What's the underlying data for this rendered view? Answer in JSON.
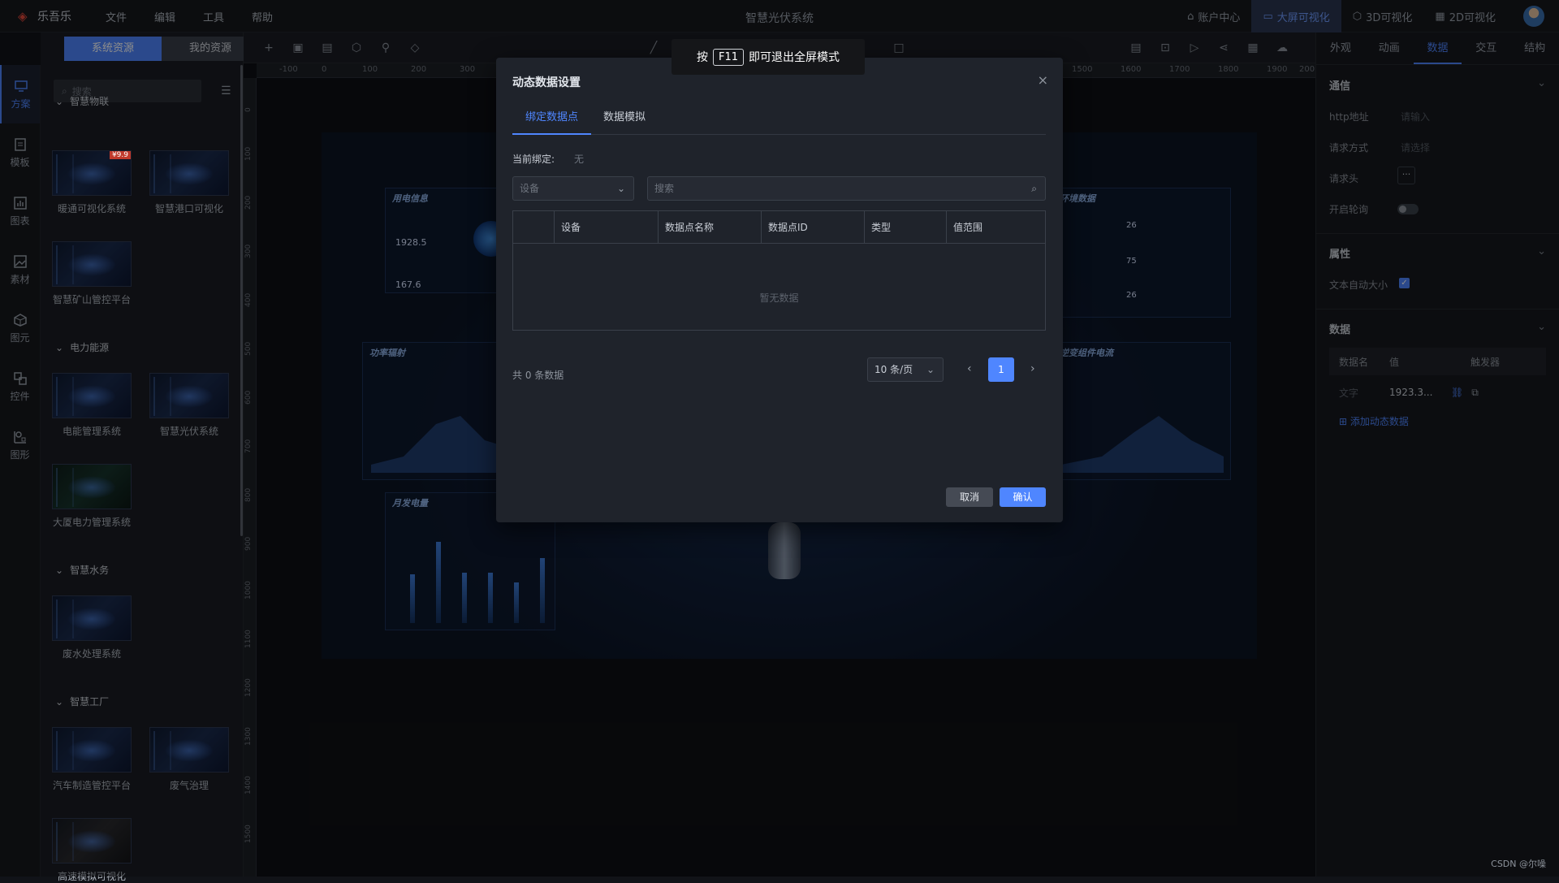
{
  "app": {
    "name": "乐吾乐",
    "title": "智慧光伏系统",
    "menu": [
      "文件",
      "编辑",
      "工具",
      "帮助"
    ],
    "right_buttons": [
      {
        "icon": "home-icon",
        "label": "账户中心",
        "active": false
      },
      {
        "icon": "monitor-icon",
        "label": "大屏可视化",
        "active": true
      },
      {
        "icon": "cube-icon",
        "label": "3D可视化",
        "active": false
      },
      {
        "icon": "grid-icon",
        "label": "2D可视化",
        "active": false
      }
    ],
    "accent": "#4f86ff"
  },
  "sidebar": {
    "items": [
      {
        "icon": "monitor-icon",
        "label": "方案",
        "active": true
      },
      {
        "icon": "template-icon",
        "label": "模板",
        "active": false
      },
      {
        "icon": "chart-icon",
        "label": "图表",
        "active": false
      },
      {
        "icon": "image-icon",
        "label": "素材",
        "active": false
      },
      {
        "icon": "cube-icon",
        "label": "图元",
        "active": false
      },
      {
        "icon": "control-icon",
        "label": "控件",
        "active": false
      },
      {
        "icon": "shape-icon",
        "label": "图形",
        "active": false
      }
    ]
  },
  "resources": {
    "tabs": [
      "系统资源",
      "我的资源"
    ],
    "search_placeholder": "搜索",
    "categories": [
      {
        "name": "智慧物联",
        "items": [
          "暖通可视化系统",
          "智慧港口可视化",
          "智慧矿山管控平台"
        ],
        "badge": "¥9.9"
      },
      {
        "name": "电力能源",
        "items": [
          "电能管理系统",
          "智慧光伏系统",
          "大厦电力管理系统"
        ]
      },
      {
        "name": "智慧水务",
        "items": [
          "废水处理系统"
        ]
      },
      {
        "name": "智慧工厂",
        "items": [
          "汽车制造管控平台",
          "废气治理",
          "高速模拟可视化"
        ]
      }
    ]
  },
  "stage": {
    "panels": [
      "用电信息",
      "功率辐射",
      "月发电量",
      "环境数据",
      "逆变组件电流"
    ],
    "values": [
      "1928.5",
      "167.6",
      "26",
      "75",
      "26"
    ]
  },
  "ruler": {
    "top": [
      "-100",
      "0",
      "100",
      "200",
      "300",
      "1500",
      "1600",
      "1700",
      "1800",
      "1900",
      "200"
    ],
    "left": [
      "0",
      "100",
      "200",
      "300",
      "400",
      "500",
      "600",
      "700",
      "800",
      "900",
      "1000",
      "1100",
      "1200",
      "1300",
      "1400",
      "1500"
    ]
  },
  "toast": {
    "prefix": "按",
    "key": "F11",
    "suffix": "即可退出全屏模式"
  },
  "modal": {
    "title": "动态数据设置",
    "close": "×",
    "tabs": [
      "绑定数据点",
      "数据模拟"
    ],
    "current_binding_label": "当前绑定:",
    "current_binding_value": "无",
    "device_placeholder": "设备",
    "search_placeholder": "搜索",
    "columns": [
      "",
      "设备",
      "数据点名称",
      "数据点ID",
      "类型",
      "值范围"
    ],
    "empty_text": "暂无数据",
    "total": "共 0 条数据",
    "page_size": "10 条/页",
    "current_page": "1",
    "cancel": "取消",
    "confirm": "确认"
  },
  "right_panel": {
    "tabs": [
      "外观",
      "动画",
      "数据",
      "交互",
      "结构"
    ],
    "active_tab": "数据",
    "comm": {
      "title": "通信",
      "rows": [
        {
          "label": "http地址",
          "value": "请输入"
        },
        {
          "label": "请求方式",
          "value": "请选择"
        },
        {
          "label": "请求头",
          "value": "···"
        },
        {
          "label": "开启轮询",
          "value": ""
        }
      ]
    },
    "attrs": {
      "title": "属性",
      "rows": [
        {
          "label": "文本自动大小",
          "checked": true
        }
      ]
    },
    "data": {
      "title": "数据",
      "columns": [
        "数据名",
        "值",
        "触发器"
      ],
      "row": {
        "name": "文字",
        "value": "1923.3..."
      },
      "add_label": "添加动态数据"
    }
  },
  "watermark": "CSDN @尔噪"
}
